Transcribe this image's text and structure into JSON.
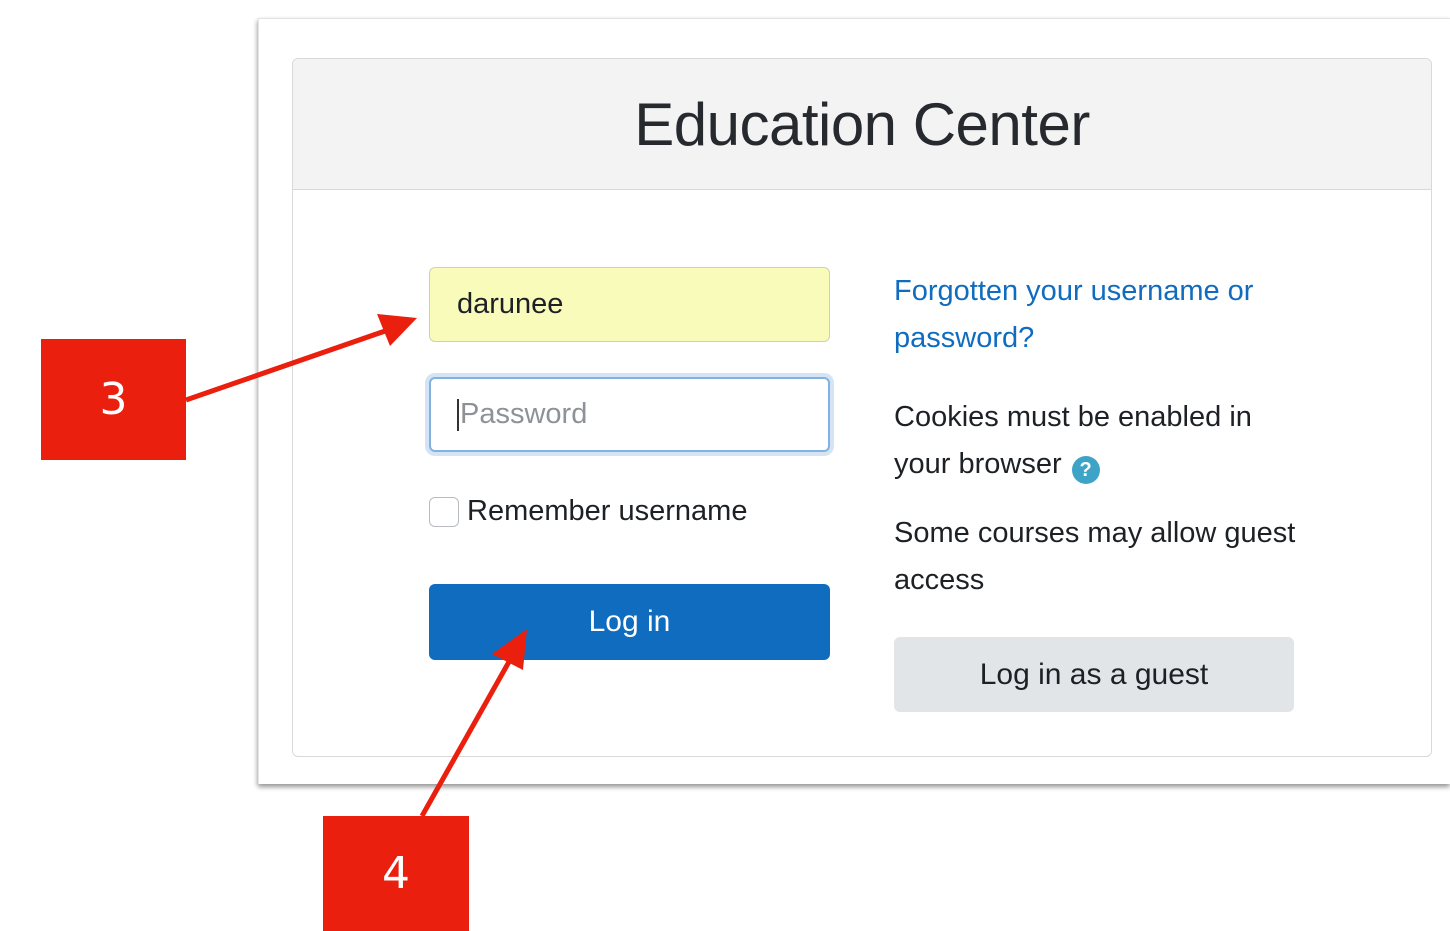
{
  "header": {
    "title": "Education Center"
  },
  "login_form": {
    "username_value": "darunee",
    "password_placeholder": "Password",
    "remember_label": "Remember username",
    "login_button": "Log in"
  },
  "side_info": {
    "forgot_link": "Forgotten your username or password?",
    "cookies_text": "Cookies must be enabled in your browser",
    "help_icon": "question-circle-icon",
    "guest_text": "Some courses may allow guest access",
    "guest_button": "Log in as a guest"
  },
  "annotations": {
    "callout_1": "3",
    "callout_2": "4",
    "color": "#ea1f0e"
  },
  "colors": {
    "primary": "#0f6cbf",
    "autofill_bg": "#f9fbbb",
    "header_bg": "#f3f3f3"
  }
}
